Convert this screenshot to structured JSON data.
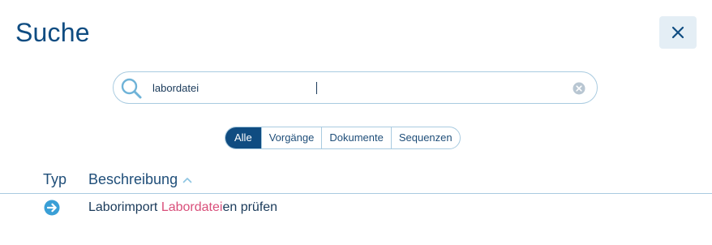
{
  "header": {
    "title": "Suche",
    "close_icon": "close-icon"
  },
  "search": {
    "value": "labordatei",
    "search_icon": "search-icon",
    "clear_icon": "clear-circle-icon"
  },
  "filters": {
    "items": [
      {
        "label": "Alle",
        "active": true
      },
      {
        "label": "Vorgänge",
        "active": false
      },
      {
        "label": "Dokumente",
        "active": false
      },
      {
        "label": "Sequenzen",
        "active": false
      }
    ]
  },
  "table": {
    "columns": {
      "type": "Typ",
      "description": "Beschreibung",
      "sort_icon": "chevron-up-icon"
    },
    "rows": [
      {
        "type_icon": "arrow-right-circle-icon",
        "description_before": "Laborimport ",
        "description_match": "Labordatei",
        "description_after": "en prüfen"
      }
    ]
  },
  "colors": {
    "primary": "#0f4c81",
    "border": "#a9cbe0",
    "highlight": "#d94f7a",
    "close_bg": "#e4eef5"
  }
}
